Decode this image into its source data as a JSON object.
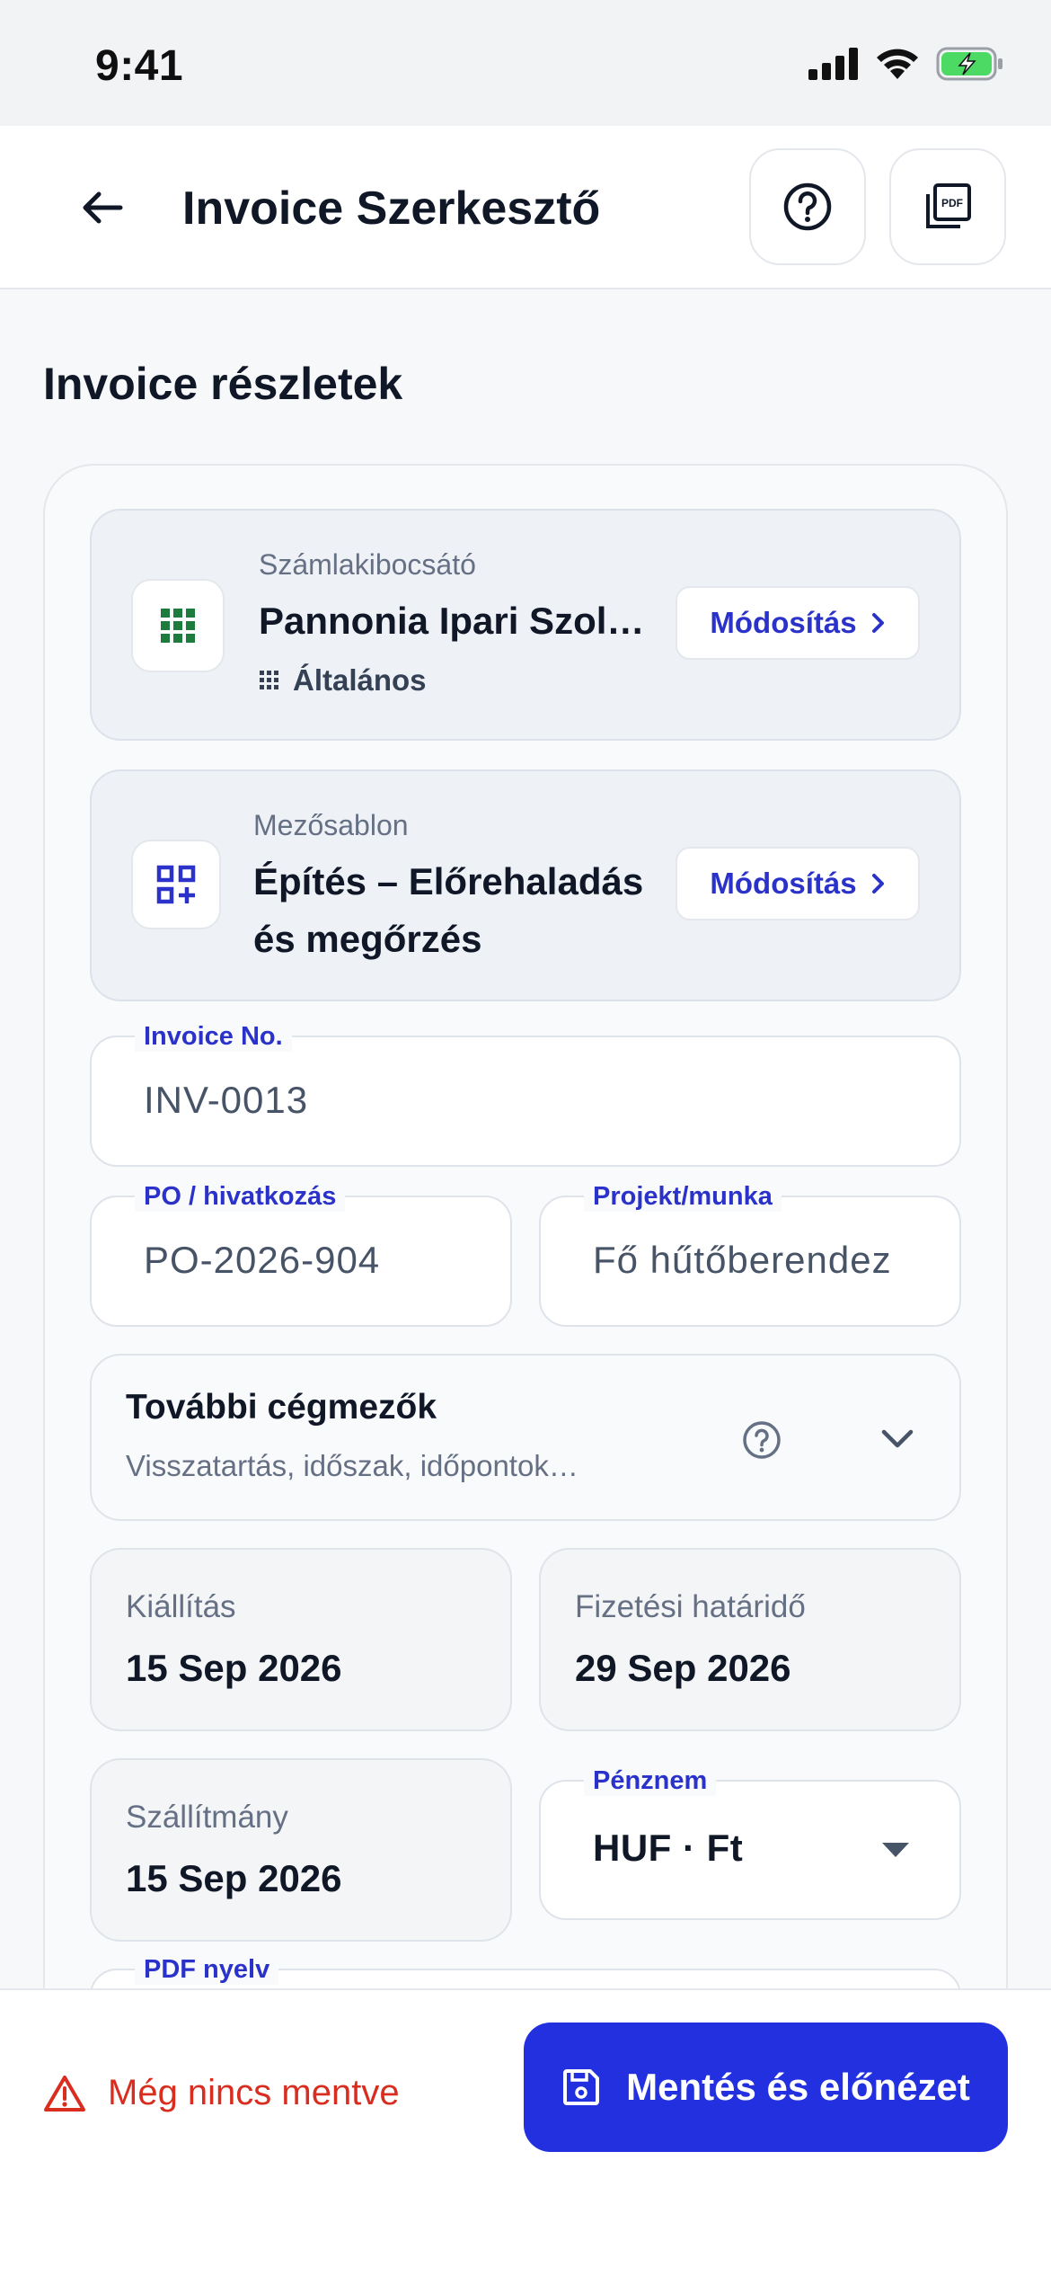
{
  "status_bar": {
    "time": "9:41"
  },
  "header": {
    "title": "Invoice Szerkesztő"
  },
  "section_title": "Invoice részletek",
  "issuer": {
    "label": "Számlakibocsátó",
    "value": "Pannonia Ipari Szol…",
    "sub": "Általános",
    "modify_label": "Módosítás"
  },
  "template": {
    "label": "Mezősablon",
    "value_line1": "Építés – Előrehaladás",
    "value_line2": "és megőrzés",
    "modify_label": "Módosítás"
  },
  "fields": {
    "invoice_no": {
      "label": "Invoice No.",
      "value": "INV-0013"
    },
    "po": {
      "label": "PO / hivatkozás",
      "value": "PO-2026-904"
    },
    "project": {
      "label": "Projekt/munka",
      "value": "Fő hűtőberendez"
    }
  },
  "more_fields": {
    "title": "További cégmezők",
    "subtitle": "Visszatartás, időszak, időpontok…"
  },
  "dates": {
    "issue": {
      "label": "Kiállítás",
      "value": "15 Sep 2026"
    },
    "due": {
      "label": "Fizetési határidő",
      "value": "29 Sep 2026"
    },
    "delivery": {
      "label": "Szállítmány",
      "value": "15 Sep 2026"
    }
  },
  "currency": {
    "label": "Pénznem",
    "value": "HUF · Ft"
  },
  "pdf_language": {
    "label": "PDF nyelv"
  },
  "footer": {
    "unsaved": "Még nincs mentve",
    "save_label": "Mentés és előnézet"
  },
  "colors": {
    "accent": "#2330e0",
    "error": "#d92d20",
    "issuer_icon": "#1e7b3e"
  },
  "icons": {
    "back": "arrow-left-icon",
    "help": "question-circle-icon",
    "pdf": "pdf-file-icon",
    "issuer": "grid-icon",
    "template": "add-grid-icon",
    "warning": "warning-triangle-icon",
    "save": "floppy-disk-icon"
  }
}
